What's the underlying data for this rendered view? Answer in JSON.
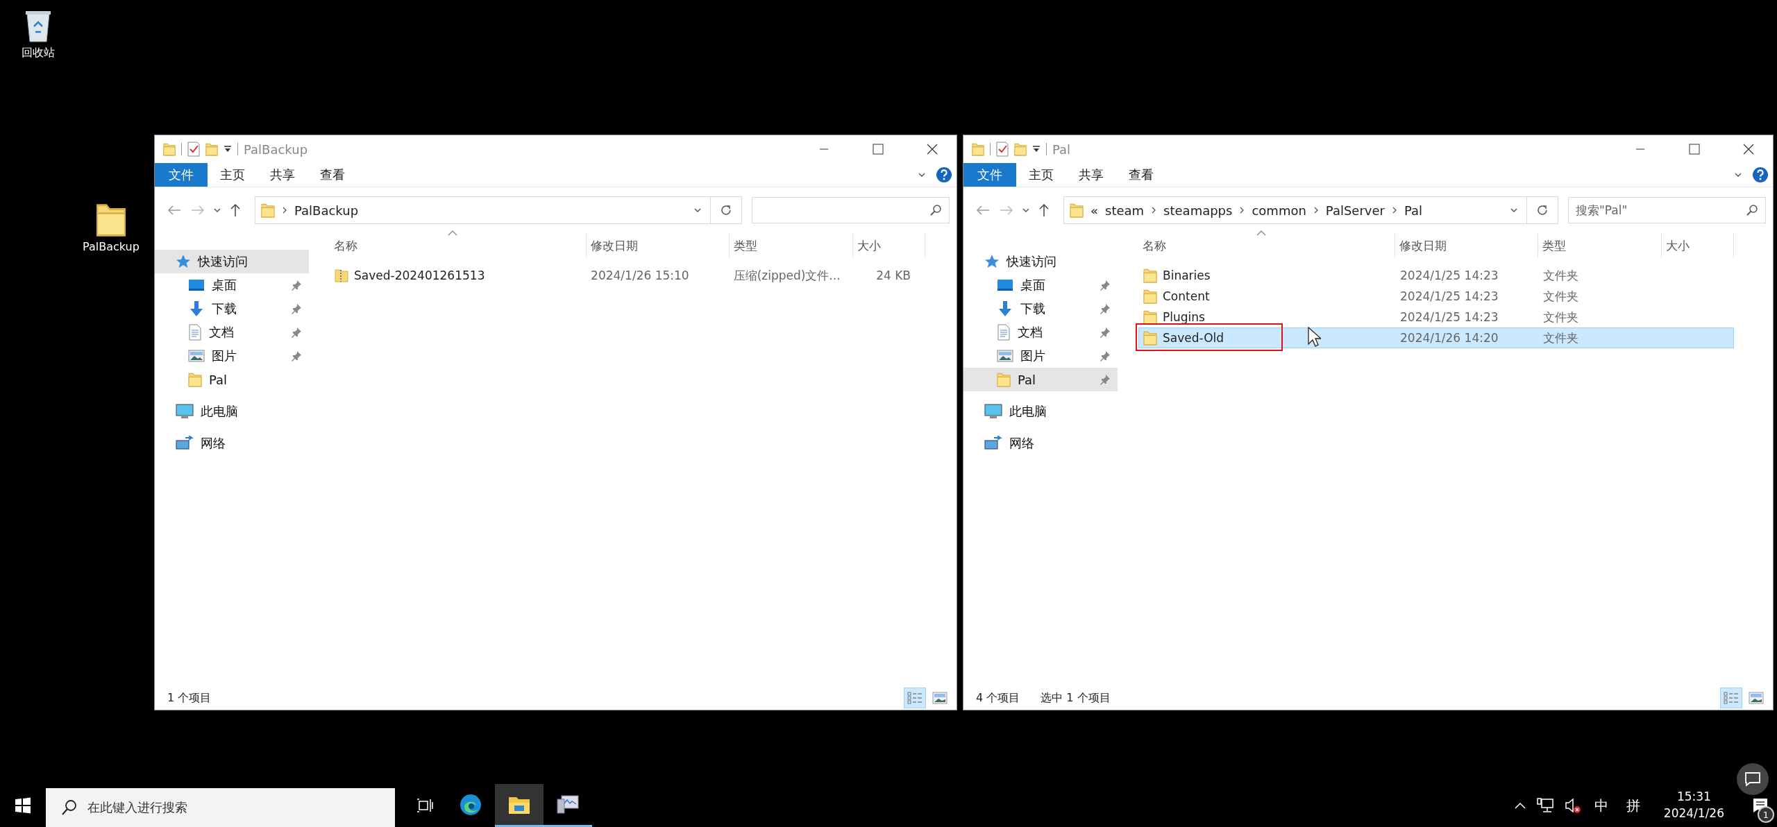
{
  "desktop_icons": [
    {
      "label": "回收站",
      "kind": "recycle-bin"
    },
    {
      "label": "PalBackup",
      "kind": "folder"
    }
  ],
  "windows": [
    {
      "title": "PalBackup",
      "ribbon_tabs": [
        {
          "label": "文件",
          "selected": true
        },
        {
          "label": "主页",
          "selected": false
        },
        {
          "label": "共享",
          "selected": false
        },
        {
          "label": "查看",
          "selected": false
        }
      ],
      "address": {
        "segments": [
          "PalBackup"
        ]
      },
      "sidebar": [
        {
          "label": "快速访问",
          "kind": "star",
          "selected": true,
          "children": [
            {
              "label": "桌面",
              "kind": "desktop",
              "pinned": true,
              "selected": false
            },
            {
              "label": "下载",
              "kind": "download",
              "pinned": true,
              "selected": false
            },
            {
              "label": "文档",
              "kind": "document",
              "pinned": true,
              "selected": false
            },
            {
              "label": "图片",
              "kind": "picture",
              "pinned": true,
              "selected": false
            },
            {
              "label": "Pal",
              "kind": "folder",
              "pinned": false,
              "selected": false
            }
          ]
        },
        {
          "label": "此电脑",
          "kind": "computer",
          "selected": false
        },
        {
          "label": "网络",
          "kind": "network",
          "selected": false
        }
      ],
      "columns": [
        "名称",
        "修改日期",
        "类型",
        "大小"
      ],
      "rows": [
        {
          "name": "Saved-202401261513",
          "kind": "zip",
          "modified": "2024/1/26 15:10",
          "type": "压缩(zipped)文件...",
          "size": "24 KB",
          "selected": false,
          "outlined": false
        }
      ],
      "status": [
        "1 个项目"
      ],
      "view_buttons": [
        {
          "kind": "details",
          "selected": true
        },
        {
          "kind": "thumbnails",
          "selected": false
        }
      ]
    },
    {
      "title": "Pal",
      "ribbon_tabs": [
        {
          "label": "文件",
          "selected": true
        },
        {
          "label": "主页",
          "selected": false
        },
        {
          "label": "共享",
          "selected": false
        },
        {
          "label": "查看",
          "selected": false
        }
      ],
      "address": {
        "overflow": "«",
        "segments": [
          "steam",
          "steamapps",
          "common",
          "PalServer",
          "Pal"
        ]
      },
      "search": {
        "placeholder": "搜索\"Pal\""
      },
      "sidebar": [
        {
          "label": "快速访问",
          "kind": "star",
          "selected": false,
          "children": [
            {
              "label": "桌面",
              "kind": "desktop",
              "pinned": true,
              "selected": false
            },
            {
              "label": "下载",
              "kind": "download",
              "pinned": true,
              "selected": false
            },
            {
              "label": "文档",
              "kind": "document",
              "pinned": true,
              "selected": false
            },
            {
              "label": "图片",
              "kind": "picture",
              "pinned": true,
              "selected": false
            },
            {
              "label": "Pal",
              "kind": "folder",
              "pinned": true,
              "selected": true
            }
          ]
        },
        {
          "label": "此电脑",
          "kind": "computer",
          "selected": false
        },
        {
          "label": "网络",
          "kind": "network",
          "selected": false
        }
      ],
      "columns": [
        "名称",
        "修改日期",
        "类型",
        "大小"
      ],
      "rows": [
        {
          "name": "Binaries",
          "kind": "folder",
          "modified": "2024/1/25 14:23",
          "type": "文件夹",
          "selected": false,
          "outlined": false
        },
        {
          "name": "Content",
          "kind": "folder",
          "modified": "2024/1/25 14:23",
          "type": "文件夹",
          "selected": false,
          "outlined": false
        },
        {
          "name": "Plugins",
          "kind": "folder",
          "modified": "2024/1/25 14:23",
          "type": "文件夹",
          "selected": false,
          "outlined": false
        },
        {
          "name": "Saved-Old",
          "kind": "folder",
          "modified": "2024/1/26 14:20",
          "type": "文件夹",
          "selected": true,
          "outlined": true
        }
      ],
      "status": [
        "4 个项目",
        "选中 1 个项目"
      ],
      "view_buttons": [
        {
          "kind": "details",
          "selected": true
        },
        {
          "kind": "thumbnails",
          "selected": false
        }
      ]
    }
  ],
  "taskbar": {
    "search_placeholder": "在此键入进行搜索",
    "apps": [
      {
        "kind": "edge",
        "running": false,
        "active": false
      },
      {
        "kind": "explorer",
        "running": true,
        "active": true
      },
      {
        "kind": "monitor",
        "running": true,
        "active": false
      }
    ],
    "volume_muted": true,
    "ime": [
      "中",
      "拼"
    ],
    "clock": {
      "time": "15:31",
      "date": "2024/1/26"
    },
    "notification_count": "1"
  }
}
